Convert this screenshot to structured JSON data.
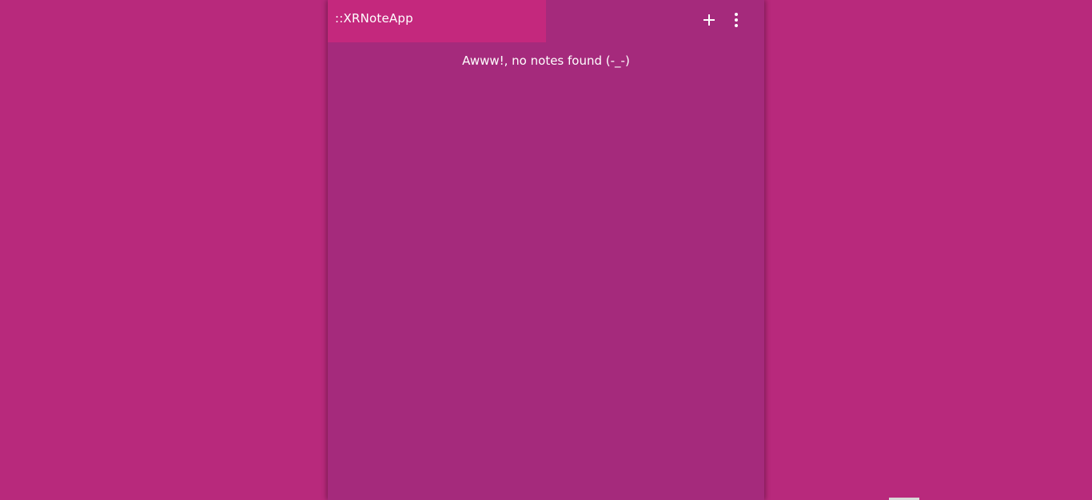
{
  "app": {
    "title": "::XRNoteApp"
  },
  "header": {
    "add_icon": "plus-icon",
    "more_icon": "more-vertical-icon"
  },
  "main": {
    "empty_message": "Awww!, no notes found (-_-)"
  },
  "colors": {
    "page_background": "#b8297c",
    "panel_background": "#a52a7c",
    "title_background": "#c4287d",
    "text": "#ffffff"
  }
}
